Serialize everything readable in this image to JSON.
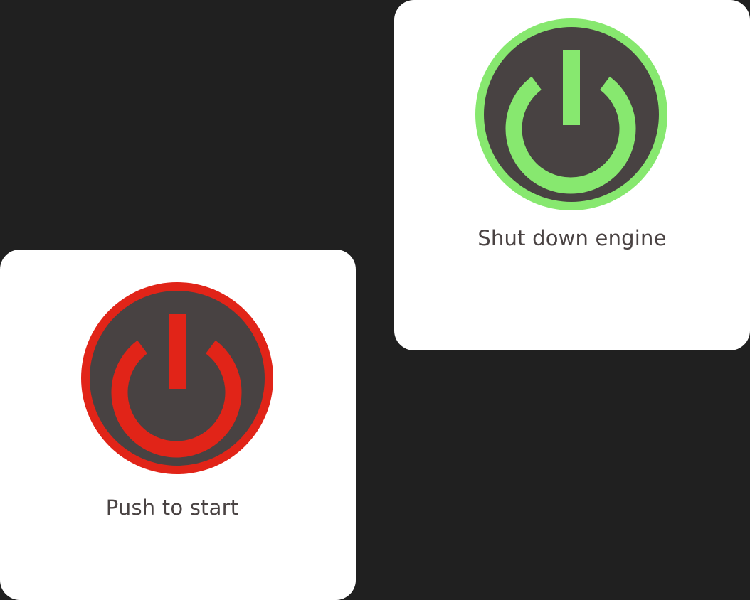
{
  "theme": {
    "background": "#202020",
    "card_background": "#ffffff",
    "button_face": "#484242",
    "caption_color": "#4a4343"
  },
  "controls": [
    {
      "id": "shutdown",
      "label": "Shut down engine",
      "state": "on",
      "accent": "#87e86f",
      "icon": "power-icon"
    },
    {
      "id": "start",
      "label": "Push to start",
      "state": "off",
      "accent": "#e12418",
      "icon": "power-icon"
    }
  ]
}
